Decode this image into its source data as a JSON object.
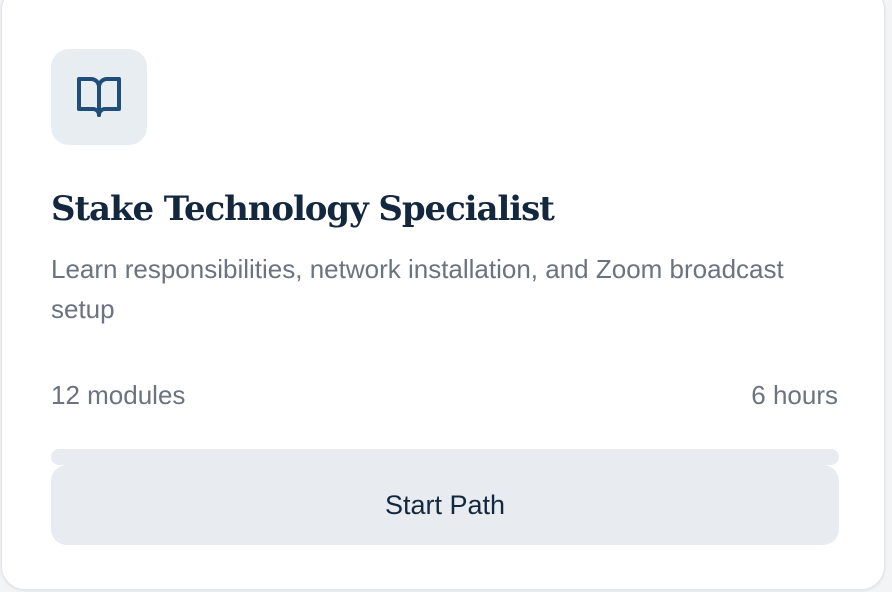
{
  "card": {
    "icon": "book-open-icon",
    "title": "Stake Technology Specialist",
    "description": "Learn responsibilities, network installation, and Zoom broadcast setup",
    "modules": "12 modules",
    "duration": "6 hours",
    "progress": 0,
    "button_label": "Start Path"
  },
  "colors": {
    "card_background": "#ffffff",
    "icon_tile": "#e8edf2",
    "icon_stroke": "#1e4e79",
    "title": "#13283f",
    "muted_text": "#6b7280",
    "track": "#e8ebef",
    "button_background": "#e8ebef"
  }
}
